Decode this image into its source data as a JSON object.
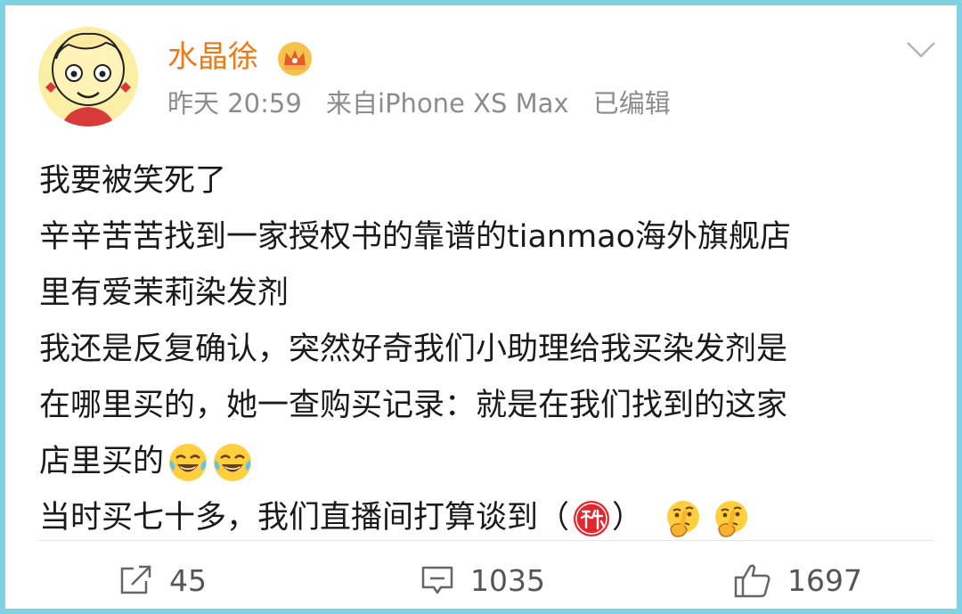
{
  "post": {
    "username": "水晶徐",
    "badge_icon": "crown-vip-icon",
    "time": "昨天 20:59",
    "source": "来自iPhone XS Max",
    "edited": "已编辑",
    "menu_icon": "chevron-down-icon",
    "lines": [
      "我要被笑死了",
      "辛辛苦苦找到一家授权书的靠谱的tianmao海外旗舰店",
      "里有爱茉莉染发剂",
      "我还是反复确认，突然好奇我们小助理给我买染发剂是",
      "在哪里买的，她一查购买记录：就是在我们找到的这家",
      "店里买的",
      "当时买七十多，我们直播间打算谈到（",
      "）"
    ],
    "emojis": [
      "laugh-cry-emoji",
      "laugh-cry-emoji",
      "secret-emoji",
      "thinking-emoji",
      "thinking-emoji"
    ]
  },
  "actions": {
    "repost_count": "45",
    "comment_count": "1035",
    "like_count": "1697"
  },
  "colors": {
    "frame": "#7fd2e2",
    "username": "#ec7a17",
    "meta": "#8c8c8c"
  }
}
